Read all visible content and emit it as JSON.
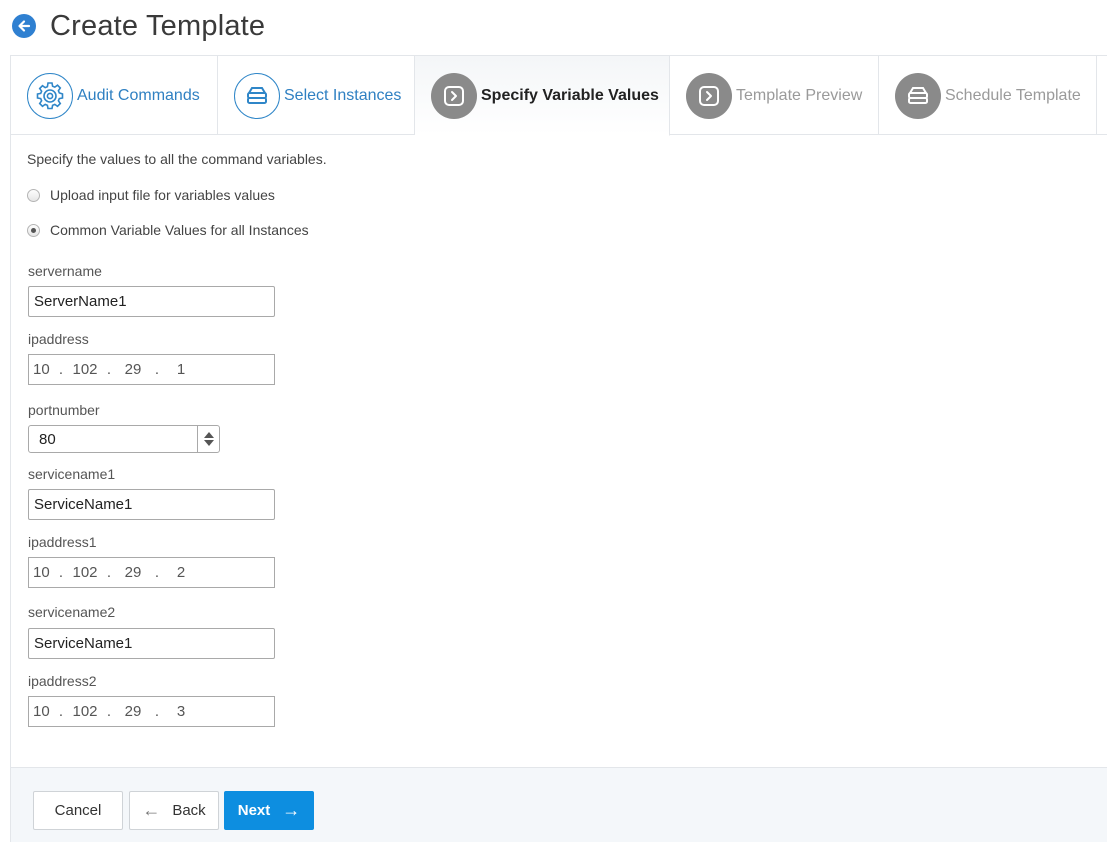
{
  "header": {
    "title": "Create Template",
    "back_icon": "arrow-left-circle-icon"
  },
  "steps": [
    {
      "label": "Audit Commands",
      "icon": "gear-icon",
      "state": "done"
    },
    {
      "label": "Select Instances",
      "icon": "server-stack-icon",
      "state": "done"
    },
    {
      "label": "Specify Variable Values",
      "icon": "chevron-right-square-icon",
      "state": "active"
    },
    {
      "label": "Template Preview",
      "icon": "chevron-right-square-icon",
      "state": "pending"
    },
    {
      "label": "Schedule Template",
      "icon": "server-stack-icon",
      "state": "pending"
    }
  ],
  "form": {
    "intro": "Specify the values to all the command variables.",
    "options": [
      {
        "label": "Upload input file for variables values",
        "checked": false
      },
      {
        "label": "Common Variable Values for all Instances",
        "checked": true
      }
    ],
    "fields": {
      "servername": {
        "label": "servername",
        "value": "ServerName1"
      },
      "ipaddress": {
        "label": "ipaddress",
        "octets": [
          "10",
          "102",
          "29",
          "1"
        ]
      },
      "portnumber": {
        "label": "portnumber",
        "value": "80"
      },
      "servicename1": {
        "label": "servicename1",
        "value": "ServiceName1"
      },
      "ipaddress1": {
        "label": "ipaddress1",
        "octets": [
          "10",
          "102",
          "29",
          "2"
        ]
      },
      "servicename2": {
        "label": "servicename2",
        "value": "ServiceName1"
      },
      "ipaddress2": {
        "label": "ipaddress2",
        "octets": [
          "10",
          "102",
          "29",
          "3"
        ]
      }
    },
    "ip_separator": "."
  },
  "footer": {
    "cancel_label": "Cancel",
    "back_label": "Back",
    "next_label": "Next"
  },
  "colors": {
    "accent": "#0d8ee0",
    "step_done": "#2f80c2",
    "step_pending": "#8a8a8a"
  }
}
